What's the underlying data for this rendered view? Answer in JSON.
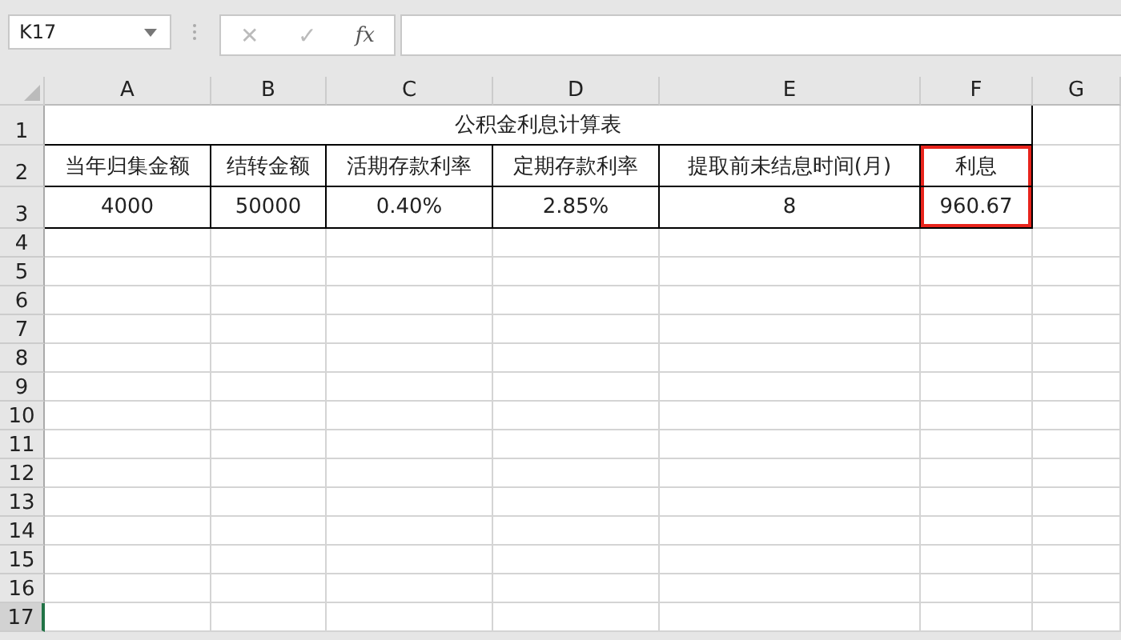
{
  "name_box": {
    "value": "K17"
  },
  "formula_bar": {
    "cancel": "✕",
    "enter": "✓",
    "function": "fx"
  },
  "columns": [
    {
      "label": "A"
    },
    {
      "label": "B"
    },
    {
      "label": "C"
    },
    {
      "label": "D"
    },
    {
      "label": "E"
    },
    {
      "label": "F"
    },
    {
      "label": "G"
    }
  ],
  "rows": [
    {
      "label": "1",
      "kind": "title",
      "selected": false,
      "cells": [
        {
          "text": "公积金利息计算表",
          "framed": false
        }
      ]
    },
    {
      "label": "2",
      "kind": "data",
      "selected": false,
      "cells": [
        {
          "text": "当年归集金额",
          "framed": false
        },
        {
          "text": "结转金额",
          "framed": false
        },
        {
          "text": "活期存款利率",
          "framed": false
        },
        {
          "text": "定期存款利率",
          "framed": false
        },
        {
          "text": "提取前未结息时间(月)",
          "framed": false
        },
        {
          "text": "利息",
          "framed": true
        }
      ]
    },
    {
      "label": "3",
      "kind": "data",
      "selected": false,
      "cells": [
        {
          "text": "4000",
          "framed": false
        },
        {
          "text": "50000",
          "framed": false
        },
        {
          "text": "0.40%",
          "framed": false
        },
        {
          "text": "2.85%",
          "framed": false
        },
        {
          "text": "8",
          "framed": false
        },
        {
          "text": "960.67",
          "framed": true
        }
      ]
    },
    {
      "label": "4",
      "kind": "empty",
      "selected": false
    },
    {
      "label": "5",
      "kind": "empty",
      "selected": false
    },
    {
      "label": "6",
      "kind": "empty",
      "selected": false
    },
    {
      "label": "7",
      "kind": "empty",
      "selected": false
    },
    {
      "label": "8",
      "kind": "empty",
      "selected": false
    },
    {
      "label": "9",
      "kind": "empty",
      "selected": false
    },
    {
      "label": "10",
      "kind": "empty",
      "selected": false
    },
    {
      "label": "11",
      "kind": "empty",
      "selected": false
    },
    {
      "label": "12",
      "kind": "empty",
      "selected": false
    },
    {
      "label": "13",
      "kind": "empty",
      "selected": false
    },
    {
      "label": "14",
      "kind": "empty",
      "selected": false
    },
    {
      "label": "15",
      "kind": "empty",
      "selected": false
    },
    {
      "label": "16",
      "kind": "empty",
      "selected": false
    },
    {
      "label": "17",
      "kind": "empty",
      "selected": true
    }
  ]
}
